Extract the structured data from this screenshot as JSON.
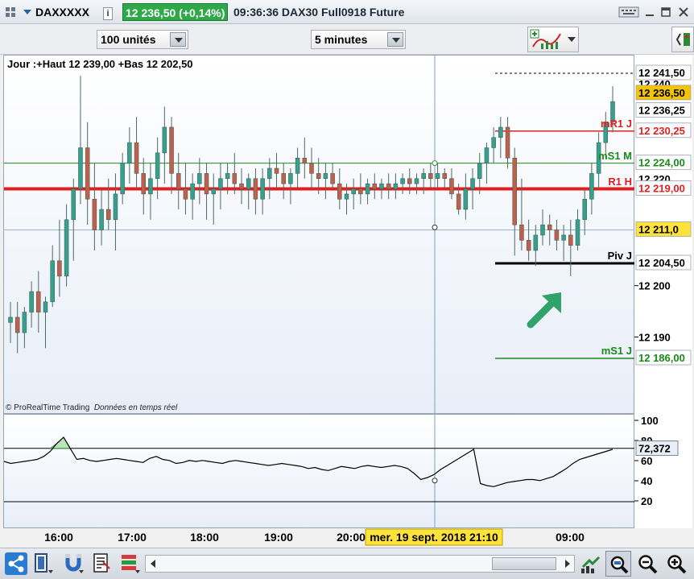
{
  "titlebar": {
    "symbol": "DAXXXXX",
    "price_badge": "12 236,50 (+0,14%)",
    "info": "09:36:36 DAX30 Full0918 Future",
    "info_icon": "i"
  },
  "toolbar": {
    "units_value": "100 unités",
    "interval_value": "5 minutes"
  },
  "chart": {
    "header": "Jour :+Haut 12 239,00 +Bas 12 202,50",
    "credit_a": "© ProRealTime Trading",
    "credit_b": "Données en temps réel",
    "levels": [
      {
        "label": "mR1 J",
        "price_tag": "12 230,25",
        "color": "#e02020"
      },
      {
        "label": "mS1 M",
        "price_tag": "12 224,00",
        "color": "#1a8a1a"
      },
      {
        "label": "R1 H",
        "price_tag": "12 219,00",
        "color": "#e02020"
      },
      {
        "label": "Piv J",
        "price_tag": "12 204,50",
        "color": "#000000"
      },
      {
        "label": "mS1 J",
        "price_tag": "12 186,00",
        "color": "#1a8a1a"
      }
    ],
    "axis_tags": {
      "top": "12 241,50",
      "current": "12 236,50",
      "cur2": "12 236,25",
      "cross": "12 211,0",
      "t200": "12 200",
      "t190": "12 190",
      "partial": "12 240",
      "partial2": "12 220"
    },
    "osc_ticks": [
      "100",
      "80",
      "60",
      "40",
      "20"
    ],
    "osc_value": "72,372",
    "time_ticks": [
      "16:00",
      "17:00",
      "18:00",
      "19:00",
      "20:00",
      "09:00"
    ],
    "crosshair_time": "mer. 19 sept. 2018 21:10",
    "colors": {
      "up": "#3a9e8c",
      "down": "#c0604a",
      "accent_green": "#2fa36a"
    }
  },
  "chart_data": {
    "type": "candlestick",
    "ylabel": "",
    "ylim": [
      12172,
      12245
    ],
    "candles": [
      [
        12193,
        12197,
        12189,
        12194
      ],
      [
        12194,
        12197,
        12187,
        12191
      ],
      [
        12191,
        12196,
        12188,
        12195
      ],
      [
        12195,
        12201,
        12192,
        12199
      ],
      [
        12199,
        12203,
        12191,
        12195
      ],
      [
        12195,
        12198,
        12188,
        12197
      ],
      [
        12197,
        12208,
        12196,
        12205
      ],
      [
        12205,
        12213,
        12198,
        12202
      ],
      [
        12202,
        12216,
        12200,
        12213
      ],
      [
        12213,
        12221,
        12205,
        12219
      ],
      [
        12219,
        12241,
        12216,
        12227
      ],
      [
        12227,
        12232,
        12212,
        12217
      ],
      [
        12217,
        12224,
        12207,
        12211
      ],
      [
        12211,
        12219,
        12208,
        12215
      ],
      [
        12215,
        12221,
        12211,
        12213
      ],
      [
        12213,
        12222,
        12207,
        12218
      ],
      [
        12218,
        12226,
        12216,
        12224
      ],
      [
        12224,
        12231,
        12220,
        12228
      ],
      [
        12228,
        12233,
        12219,
        12222
      ],
      [
        12222,
        12225,
        12214,
        12218
      ],
      [
        12218,
        12224,
        12213,
        12221
      ],
      [
        12221,
        12229,
        12217,
        12226
      ],
      [
        12226,
        12235,
        12220,
        12231
      ],
      [
        12231,
        12233,
        12218,
        12222
      ],
      [
        12222,
        12226,
        12215,
        12219
      ],
      [
        12219,
        12224,
        12214,
        12217
      ],
      [
        12217,
        12222,
        12213,
        12220
      ],
      [
        12220,
        12225,
        12216,
        12222
      ],
      [
        12222,
        12224,
        12213,
        12218
      ],
      [
        12218,
        12222,
        12212,
        12219
      ],
      [
        12219,
        12224,
        12215,
        12221
      ],
      [
        12221,
        12224,
        12218,
        12222
      ],
      [
        12222,
        12226,
        12218,
        12220
      ],
      [
        12220,
        12223,
        12216,
        12219
      ],
      [
        12219,
        12222,
        12215,
        12221
      ],
      [
        12221,
        12223,
        12214,
        12217
      ],
      [
        12217,
        12223,
        12214,
        12221
      ],
      [
        12221,
        12225,
        12217,
        12223
      ],
      [
        12223,
        12226,
        12219,
        12222
      ],
      [
        12222,
        12224,
        12217,
        12220
      ],
      [
        12220,
        12223,
        12216,
        12222
      ],
      [
        12222,
        12227,
        12219,
        12225
      ],
      [
        12225,
        12229,
        12221,
        12224
      ],
      [
        12224,
        12227,
        12219,
        12222
      ],
      [
        12222,
        12225,
        12218,
        12221
      ],
      [
        12221,
        12224,
        12217,
        12222
      ],
      [
        12222,
        12224,
        12219,
        12220
      ],
      [
        12220,
        12223,
        12215,
        12217
      ],
      [
        12217,
        12220,
        12214,
        12218
      ],
      [
        12218,
        12221,
        12215,
        12219
      ],
      [
        12219,
        12222,
        12216,
        12218
      ],
      [
        12218,
        12221,
        12216,
        12220
      ],
      [
        12220,
        12222,
        12217,
        12219
      ],
      [
        12219,
        12221,
        12217,
        12220
      ],
      [
        12220,
        12222,
        12217,
        12219
      ],
      [
        12219,
        12222,
        12217,
        12220
      ],
      [
        12220,
        12222,
        12218,
        12221
      ],
      [
        12221,
        12223,
        12218,
        12220
      ],
      [
        12220,
        12222,
        12218,
        12221
      ],
      [
        12221,
        12223,
        12218,
        12222
      ],
      [
        12222,
        12224,
        12219,
        12221
      ],
      [
        12221,
        12224,
        12219,
        12222
      ],
      [
        12222,
        12223,
        12219,
        12221
      ],
      [
        12221,
        12223,
        12217,
        12218
      ],
      [
        12218,
        12220,
        12214,
        12215
      ],
      [
        12215,
        12222,
        12213,
        12219
      ],
      [
        12219,
        12223,
        12215,
        12221
      ],
      [
        12221,
        12226,
        12218,
        12224
      ],
      [
        12224,
        12228,
        12220,
        12227
      ],
      [
        12227,
        12231,
        12224,
        12229
      ],
      [
        12229,
        12233,
        12225,
        12231
      ],
      [
        12231,
        12233,
        12223,
        12225
      ],
      [
        12225,
        12227,
        12206,
        12212
      ],
      [
        12212,
        12221,
        12207,
        12209
      ],
      [
        12209,
        12213,
        12205,
        12207
      ],
      [
        12207,
        12212,
        12204,
        12210
      ],
      [
        12210,
        12215,
        12208,
        12212
      ],
      [
        12212,
        12214,
        12208,
        12211
      ],
      [
        12211,
        12213,
        12207,
        12209
      ],
      [
        12209,
        12212,
        12205,
        12210
      ],
      [
        12210,
        12213,
        12202,
        12208
      ],
      [
        12208,
        12215,
        12207,
        12213
      ],
      [
        12213,
        12219,
        12210,
        12217
      ],
      [
        12217,
        12224,
        12214,
        12222
      ],
      [
        12222,
        12230,
        12219,
        12228
      ],
      [
        12228,
        12234,
        12225,
        12232
      ],
      [
        12232,
        12239,
        12230,
        12236
      ]
    ],
    "levels": [
      {
        "name": "mR1 J",
        "value": 12230.25
      },
      {
        "name": "mS1 M",
        "value": 12224.0
      },
      {
        "name": "R1 H",
        "value": 12219.0
      },
      {
        "name": "Piv J",
        "value": 12204.5
      },
      {
        "name": "mS1 J",
        "value": 12186.0
      }
    ],
    "oscillator": {
      "ylim": [
        0,
        100
      ],
      "last": 72.372,
      "upper": 73,
      "lower": 20,
      "values": [
        60,
        58,
        59,
        60,
        61,
        62,
        65,
        70,
        78,
        84,
        73,
        62,
        63,
        61,
        60,
        61,
        62,
        63,
        62,
        61,
        60,
        59,
        63,
        65,
        62,
        61,
        58,
        59,
        61,
        60,
        61,
        60,
        59,
        58,
        60,
        61,
        60,
        59,
        58,
        57,
        56,
        57,
        58,
        57,
        56,
        55,
        53,
        54,
        52,
        51,
        53,
        55,
        54,
        53,
        55,
        56,
        55,
        54,
        55,
        56,
        55,
        53,
        48,
        42,
        44,
        47,
        52,
        56,
        60,
        64,
        68,
        72,
        38,
        36,
        35,
        37,
        39,
        40,
        41,
        42,
        42,
        41,
        43,
        45,
        49,
        53,
        58,
        62,
        64,
        66,
        68,
        70,
        72
      ]
    }
  }
}
